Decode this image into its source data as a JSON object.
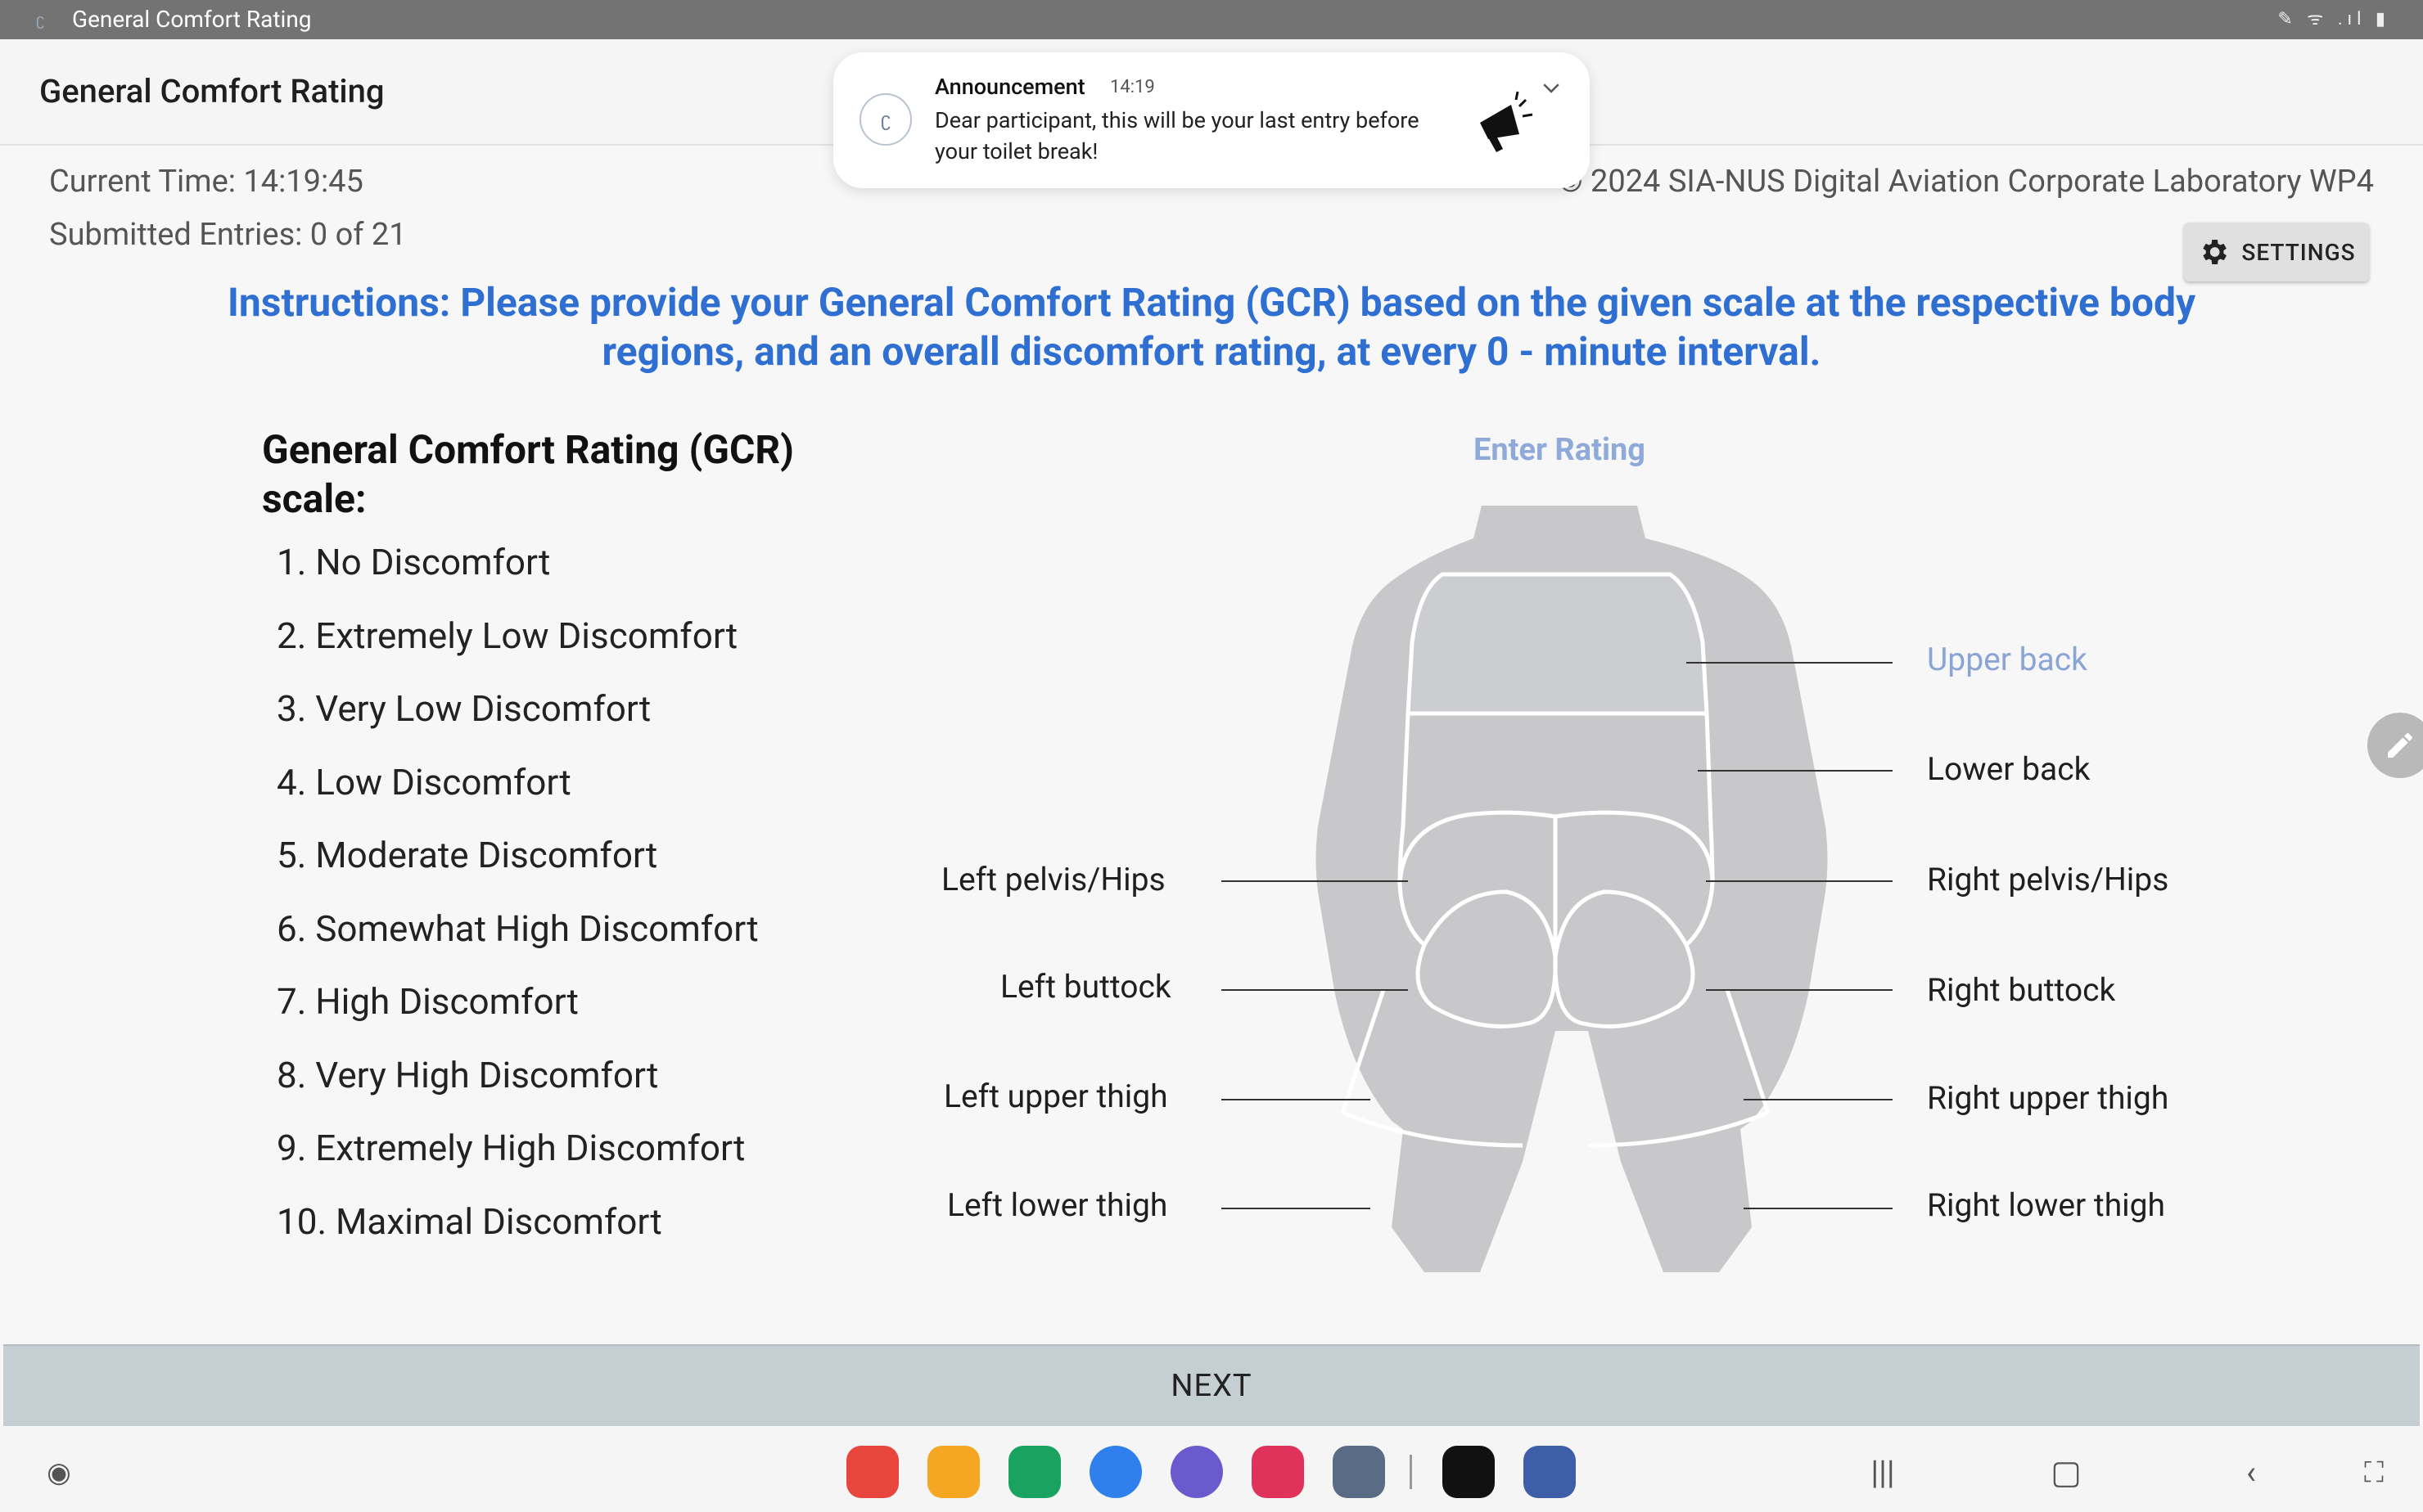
{
  "status_bar": {
    "app_title": "General Comfort Rating",
    "system_icons": "✎ ᯤ .ıl ▮"
  },
  "appbar": {
    "title": "General Comfort Rating"
  },
  "info": {
    "current_time": "Current Time: 14:19:45",
    "submitted": "Submitted Entries: 0 of 21",
    "copyright": "© 2024 SIA-NUS Digital Aviation Corporate Laboratory WP4"
  },
  "settings": {
    "label": "SETTINGS"
  },
  "instructions": "Instructions: Please provide your General Comfort Rating (GCR) based on the given scale at the respective body regions, and an overall discomfort rating, at every 0 - minute interval.",
  "scale": {
    "title": "General Comfort Rating (GCR) scale:",
    "items": [
      "1. No Discomfort",
      "2. Extremely Low Discomfort",
      "3. Very Low Discomfort",
      "4. Low Discomfort",
      "5. Moderate Discomfort",
      "6. Somewhat High Discomfort",
      "7. High Discomfort",
      "8. Very High Discomfort",
      "9. Extremely High Discomfort",
      "10. Maximal Discomfort"
    ]
  },
  "body_map": {
    "enter_rating": "Enter Rating",
    "selected_region": "Upper back",
    "regions": {
      "upper_back": "Upper back",
      "lower_back": "Lower back",
      "left_pelvis": "Left pelvis/Hips",
      "right_pelvis": "Right pelvis/Hips",
      "left_buttock": "Left buttock",
      "right_buttock": "Right buttock",
      "left_upper_thigh": "Left upper thigh",
      "right_upper_thigh": "Right upper thigh",
      "left_lower_thigh": "Left lower thigh",
      "right_lower_thigh": "Right lower thigh"
    }
  },
  "next": {
    "label": "NEXT"
  },
  "notification": {
    "title": "Announcement",
    "time": "14:19",
    "body": "Dear participant, this will be your last entry before your toilet break!"
  },
  "dock": {
    "apps": [
      {
        "name": "notes-app",
        "color": "#e8453c"
      },
      {
        "name": "files-app",
        "color": "#f5a623"
      },
      {
        "name": "phone-app",
        "color": "#1aa260"
      },
      {
        "name": "messages-app",
        "color": "#2f80ed"
      },
      {
        "name": "internet-app",
        "color": "#6a5acd"
      },
      {
        "name": "camera-app",
        "color": "#e0335c"
      },
      {
        "name": "apps-drawer",
        "color": "#5a6b85"
      },
      {
        "name": "netflix-app",
        "color": "#111111"
      },
      {
        "name": "settings-app",
        "color": "#3f5ea8"
      }
    ]
  },
  "colors": {
    "accent": "#2f6fd1",
    "selected_region": "#8aa4d6",
    "body_fill": "#c8c8ca",
    "selected_fill": "#cccdd1"
  }
}
